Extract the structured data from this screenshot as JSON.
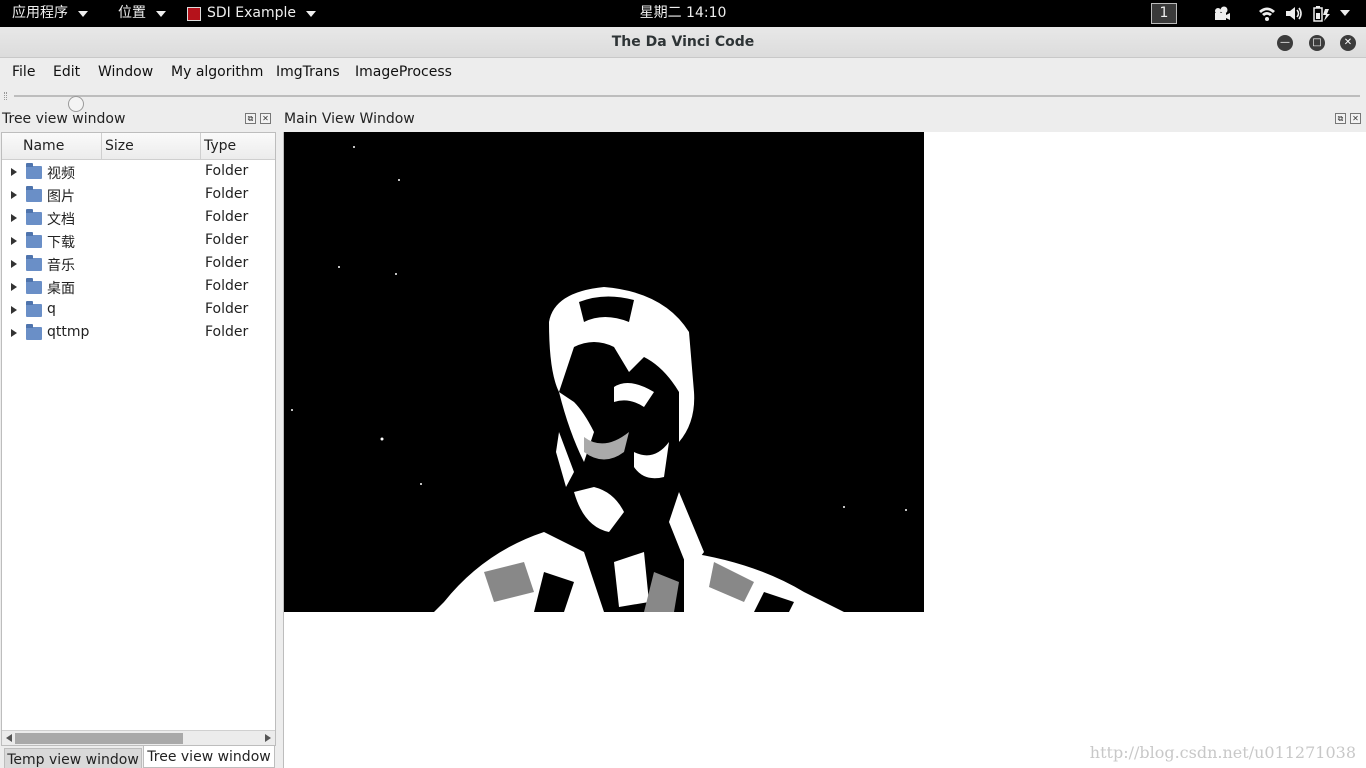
{
  "topbar": {
    "apps_label": "应用程序",
    "places_label": "位置",
    "active_app_label": "SDI Example",
    "clock": "星期二 14:10",
    "workspace": "1"
  },
  "window": {
    "title": "The Da Vinci Code"
  },
  "menubar": {
    "items": [
      "File",
      "Edit",
      "Window",
      "My algorithm",
      "ImgTrans",
      "ImageProcess"
    ]
  },
  "toolbar": {
    "slider_fraction": 0.04
  },
  "tree_dock": {
    "title": "Tree view window",
    "columns": [
      "Name",
      "Size",
      "Type"
    ],
    "rows": [
      {
        "name": "视频",
        "size": "",
        "type": "Folder"
      },
      {
        "name": "图片",
        "size": "",
        "type": "Folder"
      },
      {
        "name": "文档",
        "size": "",
        "type": "Folder"
      },
      {
        "name": "下载",
        "size": "",
        "type": "Folder"
      },
      {
        "name": "音乐",
        "size": "",
        "type": "Folder"
      },
      {
        "name": "桌面",
        "size": "",
        "type": "Folder"
      },
      {
        "name": "q",
        "size": "",
        "type": "Folder"
      },
      {
        "name": "qttmp",
        "size": "",
        "type": "Folder"
      }
    ],
    "tabs": [
      "Temp view window",
      "Tree view window"
    ],
    "active_tab": 1
  },
  "main_dock": {
    "title": "Main View Window",
    "watermark": "http://blog.csdn.net/u011271038"
  },
  "colors": {
    "accent": "#b5121b",
    "folder": "#6a8fc7"
  },
  "icons": {
    "camera": "camera-icon",
    "wifi": "wifi-icon",
    "volume": "volume-icon",
    "battery": "battery-icon",
    "minimize": "minimize-icon",
    "maximize": "maximize-icon",
    "close": "close-icon"
  }
}
